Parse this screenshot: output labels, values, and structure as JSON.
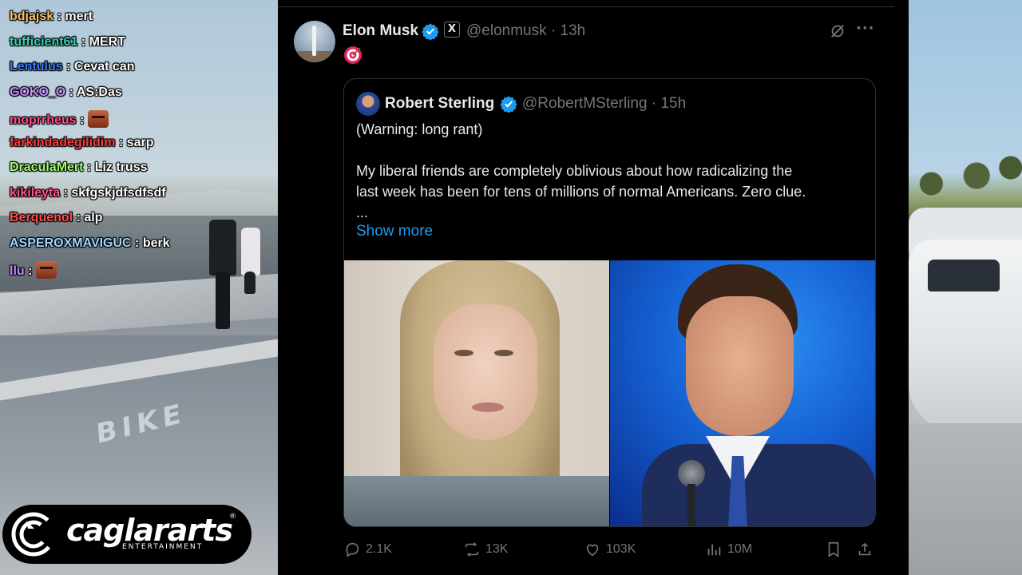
{
  "chat": {
    "messages": [
      {
        "user": "bdjajsk",
        "color": "#f5c26b",
        "text": "mert"
      },
      {
        "user": "tufficient61",
        "color": "#35d1b5",
        "text": "MERT"
      },
      {
        "user": "Lentulus",
        "color": "#3a7bf0",
        "text": "Cevat can"
      },
      {
        "user": "GOKO_O",
        "color": "#c58cff",
        "text": "AS:Das"
      },
      {
        "user": "moprrheus",
        "color": "#ff4f8f",
        "text": "",
        "emote": true
      },
      {
        "user": "farkindadegilidim",
        "color": "#ff3b3b",
        "text": "sarp"
      },
      {
        "user": "DraculaMert",
        "color": "#9dff6f",
        "text": "Liz truss"
      },
      {
        "user": "kikileyta",
        "color": "#ff4f8f",
        "text": "skfgskjdfsdfsdf"
      },
      {
        "user": "Berquenol",
        "color": "#ff5050",
        "text": "alp"
      },
      {
        "user": "ASPEROXMAVIGUC",
        "color": "#9fd6ff",
        "text": "berk"
      },
      {
        "user": "llu",
        "color": "#c58cff",
        "text": "",
        "emote": true
      }
    ]
  },
  "logo": {
    "name": "caglararts",
    "tagline": "ENTERTAINMENT",
    "reg": "®"
  },
  "tweet": {
    "author_name": "Elon Musk",
    "author_handle": "@elonmusk",
    "time": "· 13h",
    "x_badge": "X",
    "emoji": "target-emoji",
    "quote": {
      "author_name": "Robert Sterling",
      "author_handle": "@RobertMSterling",
      "time": "· 15h",
      "line1": "(Warning: long rant)",
      "line2": "My liberal friends are completely oblivious about how radicalizing the",
      "line3": "last week has been for tens of millions of normal Americans. Zero clue.",
      "line4": "...",
      "show_more": "Show more"
    },
    "actions": {
      "replies": "2.1K",
      "reposts": "13K",
      "likes": "103K",
      "views": "10M"
    }
  },
  "colors": {
    "accent": "#1d9bf0",
    "muted": "#71767b",
    "text": "#e7e9ea",
    "panel": "#000000"
  }
}
